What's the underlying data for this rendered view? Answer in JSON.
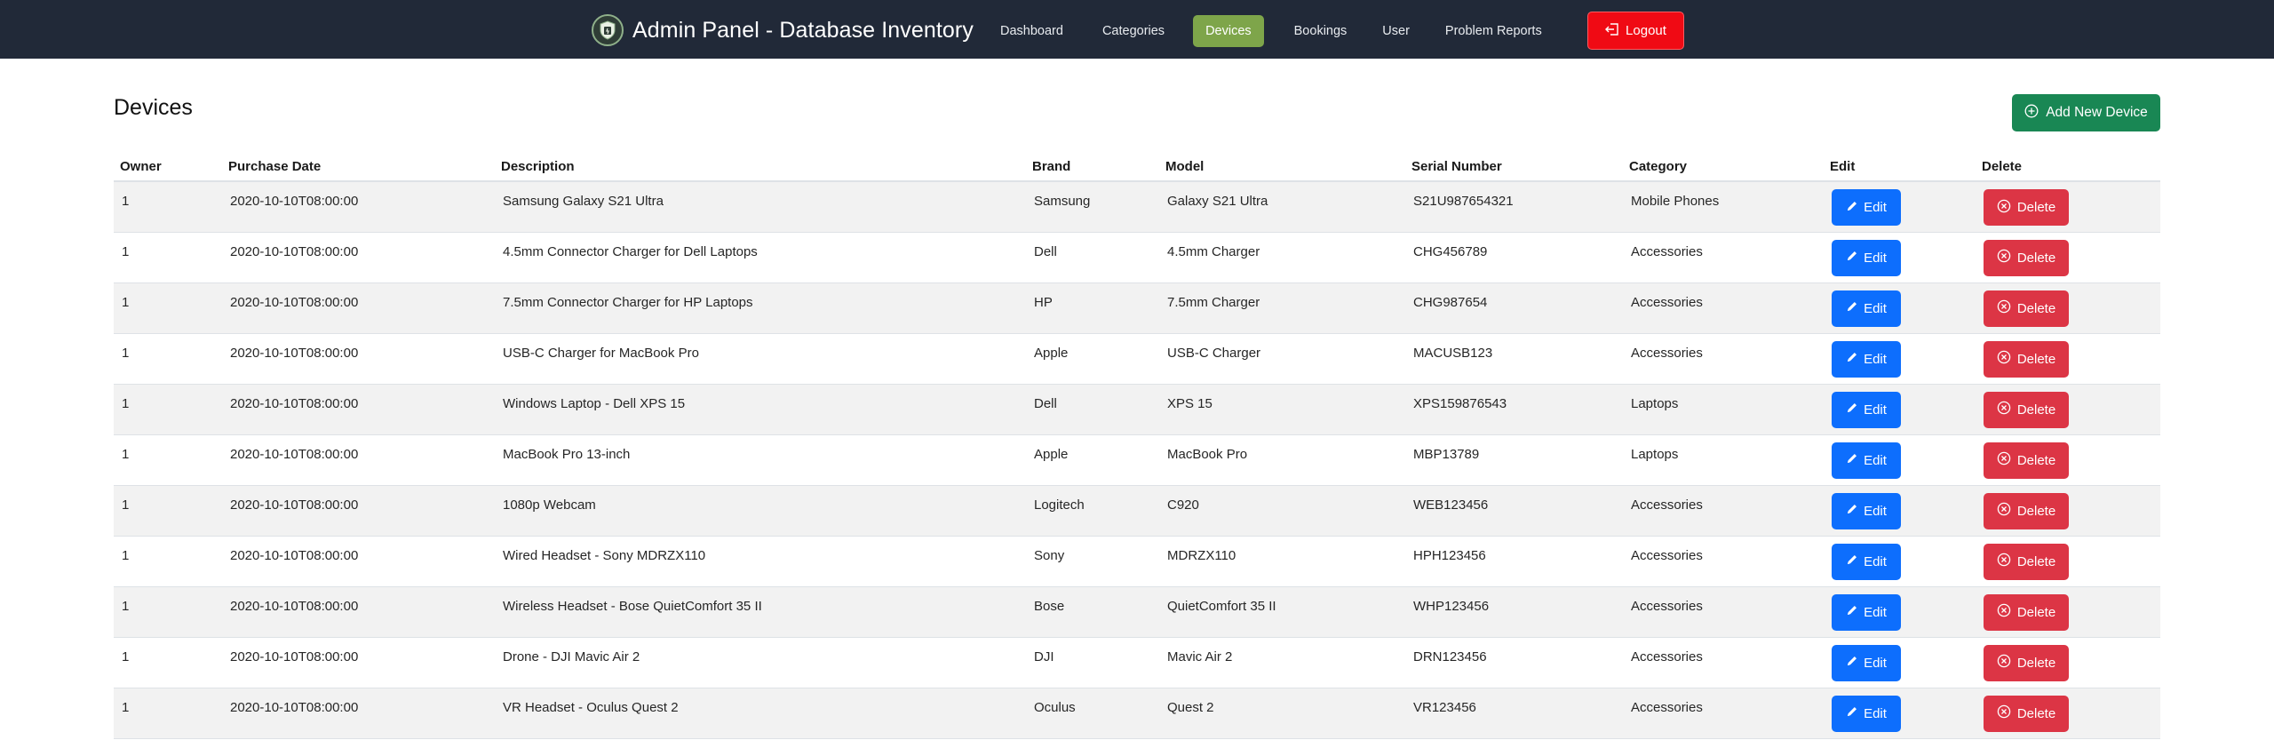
{
  "header": {
    "title": "Admin Panel - Database Inventory",
    "logo_icon": "shield-logo-icon",
    "nav": {
      "dashboard": "Dashboard",
      "categories": "Categories",
      "devices": "Devices",
      "bookings": "Bookings",
      "user": "User",
      "problem_reports": "Problem Reports"
    },
    "logout_label": "Logout",
    "colors": {
      "background": "#212938",
      "active": "#7ea54a",
      "logout": "#f00a14"
    }
  },
  "page": {
    "title": "Devices",
    "add_button_label": "Add New Device",
    "colors": {
      "add": "#198754",
      "edit": "#0d6efd",
      "delete": "#dc3545"
    }
  },
  "table": {
    "columns": {
      "owner": "Owner",
      "purchase_date": "Purchase Date",
      "description": "Description",
      "brand": "Brand",
      "model": "Model",
      "serial": "Serial Number",
      "category": "Category",
      "edit": "Edit",
      "delete": "Delete"
    },
    "edit_label": "Edit",
    "delete_label": "Delete",
    "rows": [
      {
        "owner": "1",
        "purchase_date": "2020-10-10T08:00:00",
        "description": "Samsung Galaxy S21 Ultra",
        "brand": "Samsung",
        "model": "Galaxy S21 Ultra",
        "serial": "S21U987654321",
        "category": "Mobile Phones"
      },
      {
        "owner": "1",
        "purchase_date": "2020-10-10T08:00:00",
        "description": "4.5mm Connector Charger for Dell Laptops",
        "brand": "Dell",
        "model": "4.5mm Charger",
        "serial": "CHG456789",
        "category": "Accessories"
      },
      {
        "owner": "1",
        "purchase_date": "2020-10-10T08:00:00",
        "description": "7.5mm Connector Charger for HP Laptops",
        "brand": "HP",
        "model": "7.5mm Charger",
        "serial": "CHG987654",
        "category": "Accessories"
      },
      {
        "owner": "1",
        "purchase_date": "2020-10-10T08:00:00",
        "description": "USB-C Charger for MacBook Pro",
        "brand": "Apple",
        "model": "USB-C Charger",
        "serial": "MACUSB123",
        "category": "Accessories"
      },
      {
        "owner": "1",
        "purchase_date": "2020-10-10T08:00:00",
        "description": "Windows Laptop - Dell XPS 15",
        "brand": "Dell",
        "model": "XPS 15",
        "serial": "XPS159876543",
        "category": "Laptops"
      },
      {
        "owner": "1",
        "purchase_date": "2020-10-10T08:00:00",
        "description": "MacBook Pro 13-inch",
        "brand": "Apple",
        "model": "MacBook Pro",
        "serial": "MBP13789",
        "category": "Laptops"
      },
      {
        "owner": "1",
        "purchase_date": "2020-10-10T08:00:00",
        "description": "1080p Webcam",
        "brand": "Logitech",
        "model": "C920",
        "serial": "WEB123456",
        "category": "Accessories"
      },
      {
        "owner": "1",
        "purchase_date": "2020-10-10T08:00:00",
        "description": "Wired Headset - Sony MDRZX110",
        "brand": "Sony",
        "model": "MDRZX110",
        "serial": "HPH123456",
        "category": "Accessories"
      },
      {
        "owner": "1",
        "purchase_date": "2020-10-10T08:00:00",
        "description": "Wireless Headset - Bose QuietComfort 35 II",
        "brand": "Bose",
        "model": "QuietComfort 35 II",
        "serial": "WHP123456",
        "category": "Accessories"
      },
      {
        "owner": "1",
        "purchase_date": "2020-10-10T08:00:00",
        "description": "Drone - DJI Mavic Air 2",
        "brand": "DJI",
        "model": "Mavic Air 2",
        "serial": "DRN123456",
        "category": "Accessories"
      },
      {
        "owner": "1",
        "purchase_date": "2020-10-10T08:00:00",
        "description": "VR Headset - Oculus Quest 2",
        "brand": "Oculus",
        "model": "Quest 2",
        "serial": "VR123456",
        "category": "Accessories"
      }
    ]
  }
}
